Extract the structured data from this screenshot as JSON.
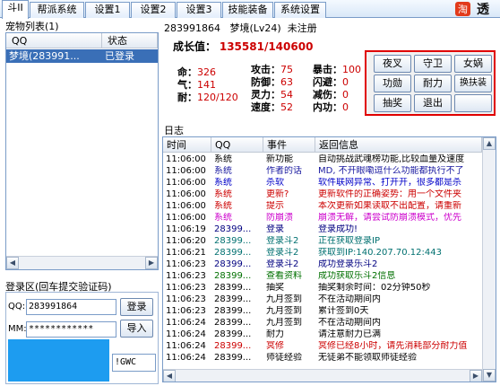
{
  "tabs": [
    "斗II",
    "帮派系统",
    "设置1",
    "设置2",
    "设置3",
    "技能装备",
    "系统设置"
  ],
  "logo_text": "淘透",
  "header": {
    "qq": "283991864",
    "name": "梦境(Lv24)",
    "status": "未注册"
  },
  "pet_list": {
    "title": "宠物列表(1)",
    "columns": [
      "QQ",
      "状态"
    ],
    "rows": [
      {
        "qq": "梦境(283991...",
        "status": "已登录"
      }
    ]
  },
  "login": {
    "title": "登录区(回车提交验证码)",
    "qq_label": "QQ:",
    "qq_value": "283991864",
    "pw_label": "MM:",
    "pw_value": "************",
    "login_btn": "登录",
    "import_btn": "导入",
    "captcha_value": "!GWC"
  },
  "stats": {
    "growth_label": "成长值：",
    "growth_value": "135581/140600",
    "life_label": "命：",
    "life_value": "326",
    "qi_label": "气：",
    "qi_value": "141",
    "dur_label": "耐：",
    "dur_value": "120/120",
    "attack_label": "攻击：",
    "attack_value": "75",
    "defense_label": "防御：",
    "defense_value": "63",
    "spirit_label": "灵力：",
    "spirit_value": "54",
    "speed_label": "速度：",
    "speed_value": "52",
    "crit_label": "暴击：",
    "crit_value": "100",
    "dodge_label": "闪避：",
    "dodge_value": "0",
    "reduce_label": "减伤：",
    "reduce_value": "0",
    "inner_label": "内功：",
    "inner_value": "0"
  },
  "action_buttons": [
    "夜叉",
    "守卫",
    "女娲",
    "功勋",
    "耐力",
    "换扶装",
    "抽奖",
    "退出",
    ""
  ],
  "log": {
    "title": "日志",
    "columns": [
      "时间",
      "QQ",
      "事件",
      "返回信息"
    ],
    "rows": [
      {
        "time": "11:06:00",
        "qq": "系统",
        "event": "新功能",
        "msg": "自动挑战武魂榜功能,比较血量及速度",
        "color": "#000000"
      },
      {
        "time": "11:06:00",
        "qq": "系统",
        "event": "作者的话",
        "msg": "MD, 不开眼嘞逗什么功能都执行不了",
        "color": "#1a1aa0"
      },
      {
        "time": "11:06:00",
        "qq": "系统",
        "event": "杀软",
        "msg": "软件联网异常、打开开，很多都是杀",
        "color": "#0000c8"
      },
      {
        "time": "11:06:00",
        "qq": "系统",
        "event": "更新?",
        "msg": "更新软件的正确姿势：用一个文件夹",
        "color": "#cc0000"
      },
      {
        "time": "11:06:00",
        "qq": "系统",
        "event": "提示",
        "msg": "本次更新如果读取不出配置，请重新",
        "color": "#cc0000"
      },
      {
        "time": "11:06:00",
        "qq": "系统",
        "event": "防崩溃",
        "msg": "崩溃无解，请尝试防崩溃模式，优先",
        "color": "#cc00cc"
      },
      {
        "time": "11:06:19",
        "qq": "28399...",
        "event": "登录",
        "msg": "登录成功!",
        "color": "#000080"
      },
      {
        "time": "11:06:20",
        "qq": "28399...",
        "event": "登录斗2",
        "msg": "正在获取登录IP",
        "color": "#007070"
      },
      {
        "time": "11:06:21",
        "qq": "28399...",
        "event": "登录斗2",
        "msg": "获取到IP:140.207.70.12:443",
        "color": "#007070"
      },
      {
        "time": "11:06:23",
        "qq": "28399...",
        "event": "登录斗2",
        "msg": "成功登录乐斗2",
        "color": "#000080"
      },
      {
        "time": "11:06:23",
        "qq": "28399...",
        "event": "查看资料",
        "msg": "成功获取乐斗2信息",
        "color": "#007000"
      },
      {
        "time": "11:06:23",
        "qq": "28399...",
        "event": "抽奖",
        "msg": "抽奖剩余时间：02分钟50秒",
        "color": "#000000"
      },
      {
        "time": "11:06:23",
        "qq": "28399...",
        "event": "九月签到",
        "msg": "不在活动期间内",
        "color": "#000000"
      },
      {
        "time": "11:06:23",
        "qq": "28399...",
        "event": "九月签到",
        "msg": "累计签到0天",
        "color": "#000000"
      },
      {
        "time": "11:06:24",
        "qq": "28399...",
        "event": "九月签到",
        "msg": "不在活动期间内",
        "color": "#000000"
      },
      {
        "time": "11:06:24",
        "qq": "28399...",
        "event": "耐力",
        "msg": "请注意耐力已满",
        "color": "#000000"
      },
      {
        "time": "11:06:24",
        "qq": "28399...",
        "event": "冥修",
        "msg": "冥修已经8小时，请先消耗部分耐力值",
        "color": "#cc0000"
      },
      {
        "time": "11:06:24",
        "qq": "28399...",
        "event": "师徒经验",
        "msg": "无徒弟不能领取师徒经验",
        "color": "#000000"
      }
    ]
  }
}
